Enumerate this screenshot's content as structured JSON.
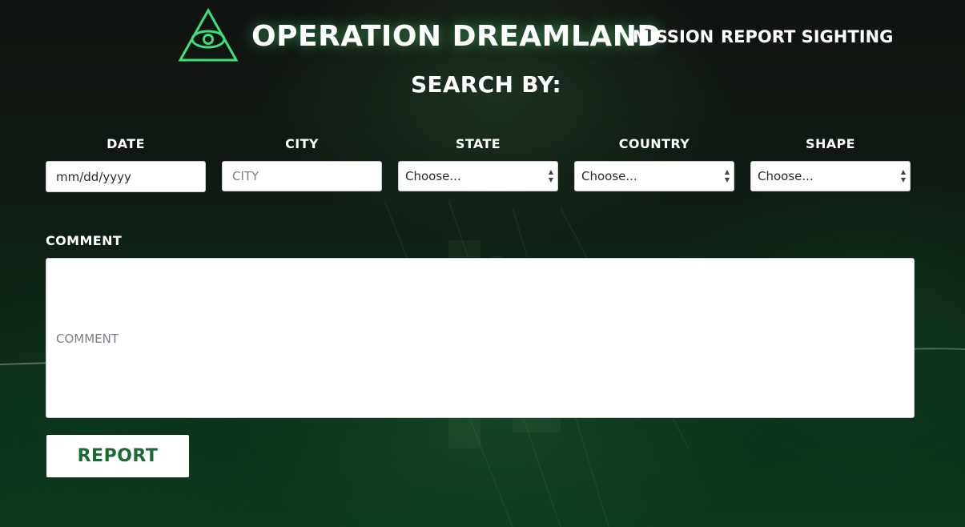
{
  "header": {
    "logo_icon": "eye-triangle-icon",
    "title": "OPERATION DREAMLAND",
    "nav": [
      {
        "label": "MISSION"
      },
      {
        "label": "REPORT SIGHTING"
      }
    ]
  },
  "search": {
    "heading": "SEARCH BY:",
    "fields": {
      "date": {
        "label": "DATE",
        "placeholder": "mm/dd/yyyy"
      },
      "city": {
        "label": "CITY",
        "placeholder": "CITY"
      },
      "state": {
        "label": "STATE",
        "selected": "Choose..."
      },
      "country": {
        "label": "COUNTRY",
        "selected": "Choose..."
      },
      "shape": {
        "label": "SHAPE",
        "selected": "Choose..."
      }
    },
    "comment": {
      "label": "COMMENT",
      "placeholder": "COMMENT"
    },
    "submit_label": "REPORT"
  },
  "colors": {
    "accent_green": "#1c6b34",
    "logo_green": "#3be07a",
    "background_dark": "#0f1a12"
  }
}
